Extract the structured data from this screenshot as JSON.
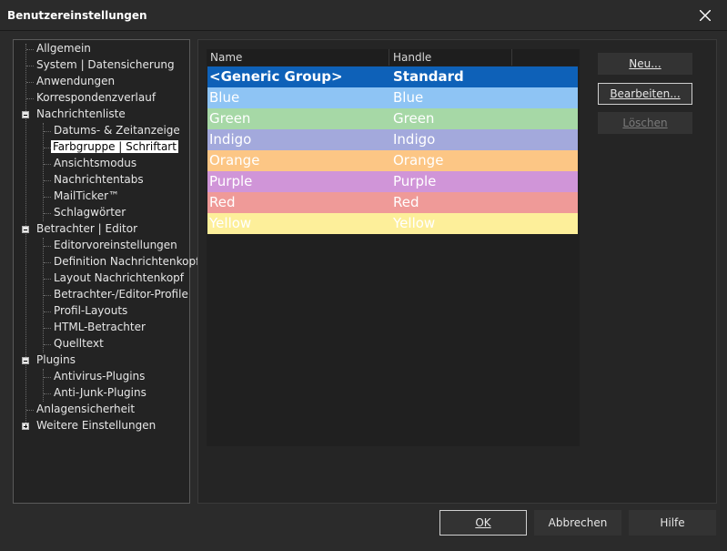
{
  "window": {
    "title": "Benutzereinstellungen"
  },
  "tree": {
    "items": [
      {
        "label": "Allgemein"
      },
      {
        "label": "System | Datensicherung"
      },
      {
        "label": "Anwendungen"
      },
      {
        "label": "Korrespondenzverlauf"
      },
      {
        "label": "Nachrichtenliste"
      },
      {
        "label": "Datums- & Zeitanzeige"
      },
      {
        "label": "Farbgruppe | Schriftart"
      },
      {
        "label": "Ansichtsmodus"
      },
      {
        "label": "Nachrichtentabs"
      },
      {
        "label": "MailTicker™"
      },
      {
        "label": "Schlagwörter"
      },
      {
        "label": "Betrachter | Editor"
      },
      {
        "label": "Editorvoreinstellungen"
      },
      {
        "label": "Definition Nachrichtenkopf"
      },
      {
        "label": "Layout Nachrichtenkopf"
      },
      {
        "label": "Betrachter-/Editor-Profile"
      },
      {
        "label": "Profil-Layouts"
      },
      {
        "label": "HTML-Betrachter"
      },
      {
        "label": "Quelltext"
      },
      {
        "label": "Plugins"
      },
      {
        "label": "Antivirus-Plugins"
      },
      {
        "label": "Anti-Junk-Plugins"
      },
      {
        "label": "Anlagensicherheit"
      },
      {
        "label": "Weitere Einstellungen"
      }
    ]
  },
  "list": {
    "columns": [
      "Name",
      "Handle"
    ],
    "rows": [
      {
        "name": "<Generic Group>",
        "handle": "Standard",
        "bg": "#0e61b8",
        "fg": "#ffffff"
      },
      {
        "name": "Blue",
        "handle": "Blue",
        "bg": "#8ec4f4",
        "fg": "#ffffff"
      },
      {
        "name": "Green",
        "handle": "Green",
        "bg": "#a6d8a6",
        "fg": "#ffffff"
      },
      {
        "name": "Indigo",
        "handle": "Indigo",
        "bg": "#a3a9dc",
        "fg": "#ffffff"
      },
      {
        "name": "Orange",
        "handle": "Orange",
        "bg": "#fcc685",
        "fg": "#ffffff"
      },
      {
        "name": "Purple",
        "handle": "Purple",
        "bg": "#d095d8",
        "fg": "#ffffff"
      },
      {
        "name": "Red",
        "handle": "Red",
        "bg": "#ef9a98",
        "fg": "#ffffff"
      },
      {
        "name": "Yellow",
        "handle": "Yellow",
        "bg": "#fdef9a",
        "fg": "#ffffff"
      }
    ]
  },
  "buttons": {
    "new": "Neu...",
    "edit": "Bearbeiten...",
    "delete": "Löschen",
    "ok": "OK",
    "cancel": "Abbrechen",
    "help": "Hilfe"
  }
}
